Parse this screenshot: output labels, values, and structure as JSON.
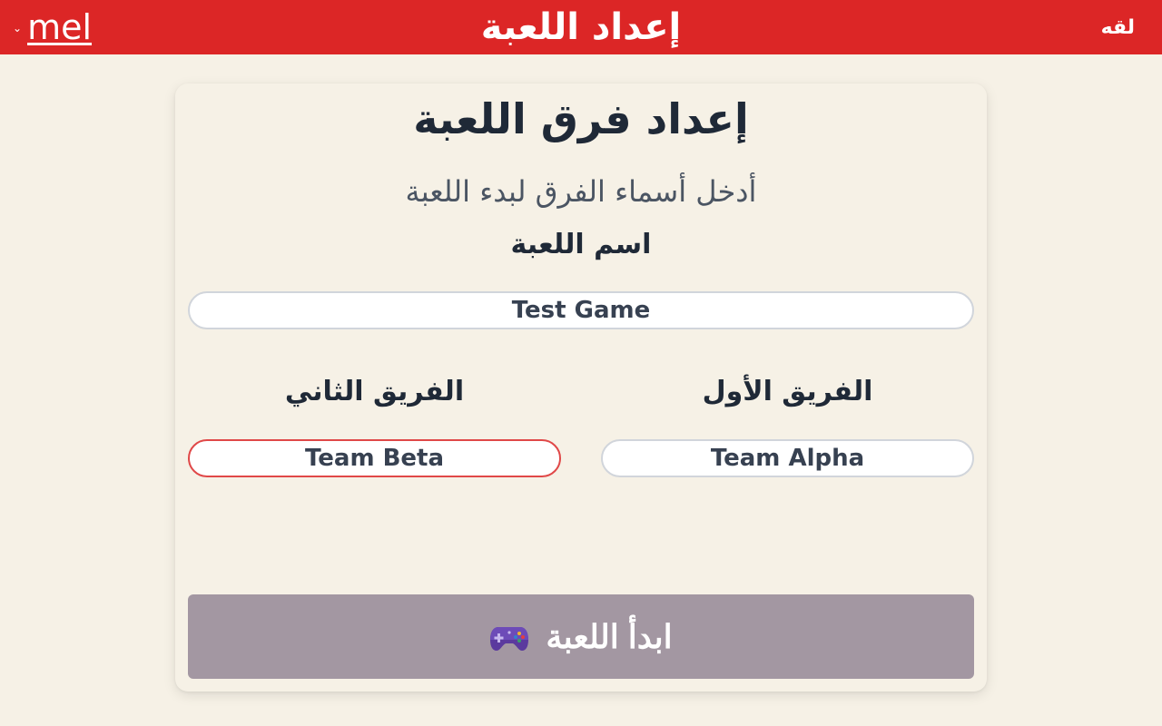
{
  "header": {
    "user_name": "mel",
    "chevron": "⌄",
    "title": "إعداد اللعبة",
    "logo_text": "لقه",
    "background_color": "#dc2626"
  },
  "card": {
    "title": "إعداد فرق اللعبة",
    "subtitle": "أدخل أسماء الفرق لبدء اللعبة"
  },
  "form": {
    "game_name_label": "اسم اللعبة",
    "game_name_value": "Test Game",
    "team1_label": "الفريق الأول",
    "team1_value": "Team Alpha",
    "team2_label": "الفريق الثاني",
    "team2_value": "Team Beta",
    "start_button_label": "ابدأ اللعبة",
    "start_button_icon": "gamepad-icon",
    "start_button_color": "#a397a2"
  }
}
